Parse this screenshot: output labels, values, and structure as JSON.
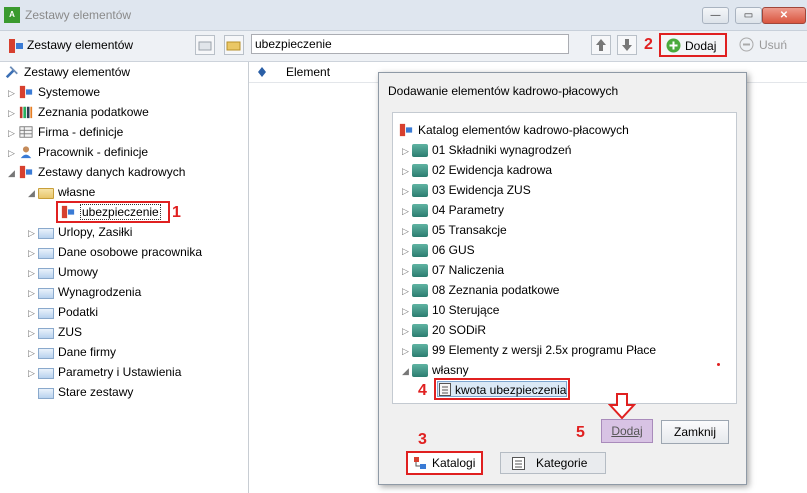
{
  "window": {
    "title": "Zestawy elementów",
    "icon": "app-grid-icon",
    "controls": [
      "minimize",
      "maximize",
      "close"
    ]
  },
  "toolbar": {
    "title": "Zestawy elementów",
    "search_value": "ubezpieczenie",
    "add_label": "Dodaj",
    "remove_label": "Usuń"
  },
  "left_tree": [
    {
      "label": "Zestawy elementów",
      "icon": "tools-icon"
    },
    {
      "label": "Systemowe",
      "icon": "elements-icon"
    },
    {
      "label": "Zeznania podatkowe",
      "icon": "books-icon"
    },
    {
      "label": "Firma - definicje",
      "icon": "table-icon"
    },
    {
      "label": "Pracownik - definicje",
      "icon": "person-icon"
    },
    {
      "label": "Zestawy danych kadrowych",
      "icon": "elements-icon"
    },
    {
      "label": "własne",
      "icon": "folder-icon"
    },
    {
      "label": "ubezpieczenie",
      "icon": "elements-icon"
    },
    {
      "label": "Urlopy, Zasiłki",
      "icon": "folder-icon"
    },
    {
      "label": "Dane osobowe pracownika",
      "icon": "folder-icon"
    },
    {
      "label": "Umowy",
      "icon": "folder-icon"
    },
    {
      "label": "Wynagrodzenia",
      "icon": "folder-icon"
    },
    {
      "label": "Podatki",
      "icon": "folder-icon"
    },
    {
      "label": "ZUS",
      "icon": "folder-icon"
    },
    {
      "label": "Dane firmy",
      "icon": "folder-icon"
    },
    {
      "label": "Parametry i Ustawienia",
      "icon": "folder-icon"
    },
    {
      "label": "Stare zestawy",
      "icon": "folder-icon"
    }
  ],
  "right_pane": {
    "column_header": "Element"
  },
  "dialog": {
    "title": "Dodawanie elementów kadrowo-płacowych",
    "tree": [
      "Katalog elementów kadrowo-płacowych",
      "01 Składniki wynagrodzeń",
      "02 Ewidencja kadrowa",
      "03 Ewidencja ZUS",
      "04 Parametry",
      "05 Transakcje",
      "06 GUS",
      "07 Naliczenia",
      "08 Zeznania podatkowe",
      "10 Sterujące",
      "20 SODiR",
      "99 Elementy z wersji 2.5x programu Płace",
      "własny",
      "kwota ubezpieczenia"
    ],
    "add_button": "Dodaj",
    "close_button": "Zamknij",
    "tabs": [
      "Katalogi",
      "Kategorie"
    ]
  },
  "annotations": [
    "1",
    "2",
    "3",
    "4",
    "5"
  ],
  "colors": {
    "highlight_red": "#e02020",
    "selection": "#dbe9f6",
    "titlebar": "#dfe6ef"
  }
}
